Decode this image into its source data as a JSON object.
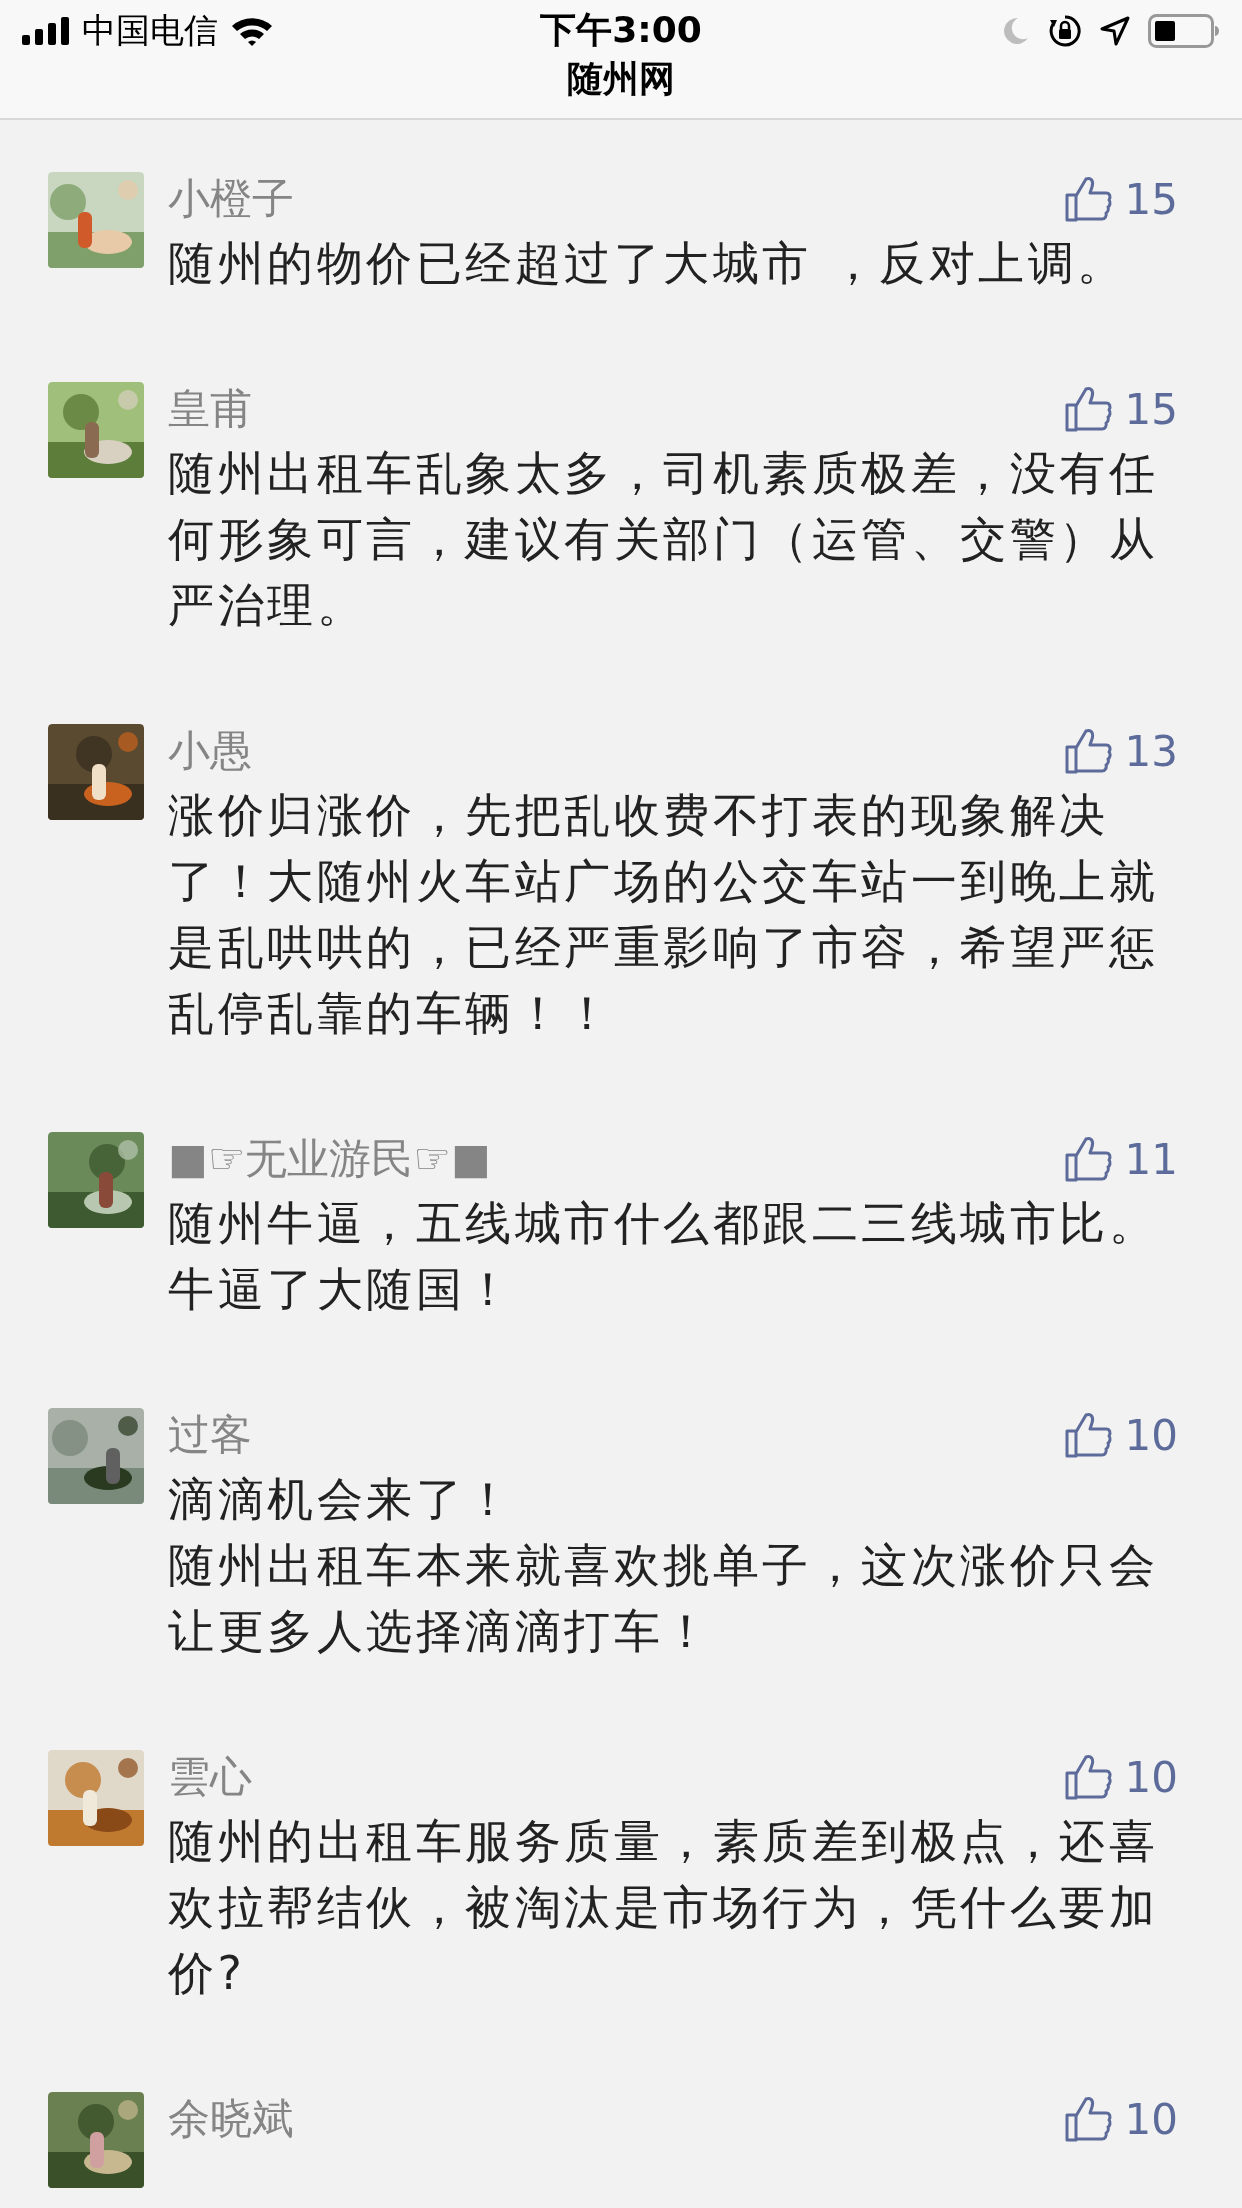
{
  "status_bar": {
    "carrier": "中国电信",
    "time": "下午3:00"
  },
  "nav": {
    "title": "随州网"
  },
  "comments": [
    {
      "name": "小橙子",
      "likes": "15",
      "text": "随州的物价已经超过了大城市 ，反对上调。"
    },
    {
      "name": "皇甫",
      "likes": "15",
      "text": "随州出租车乱象太多，司机素质极差，没有任何形象可言，建议有关部门（运管、交警）从严治理。"
    },
    {
      "name": "小愚",
      "likes": "13",
      "text": "涨价归涨价，先把乱收费不打表的现象解决了！大随州火车站广场的公交车站一到晚上就是乱哄哄的，已经严重影响了市容，希望严惩乱停乱靠的车辆！！"
    },
    {
      "name": "■☞无业游民☞■",
      "likes": "11",
      "text": "随州牛逼，五线城市什么都跟二三线城市比。牛逼了大随国！"
    },
    {
      "name": "过客",
      "likes": "10",
      "text": "滴滴机会来了！",
      "text_2": "随州出租车本来就喜欢挑单子，这次涨价只会让更多人选择滴滴打车！"
    },
    {
      "name": "雲心",
      "likes": "10",
      "text": "随州的出租车服务质量，素质差到极点，还喜欢拉帮结伙，被淘汰是市场行为，凭什么要加价?"
    },
    {
      "name": "余晓斌",
      "likes": "10"
    }
  ]
}
